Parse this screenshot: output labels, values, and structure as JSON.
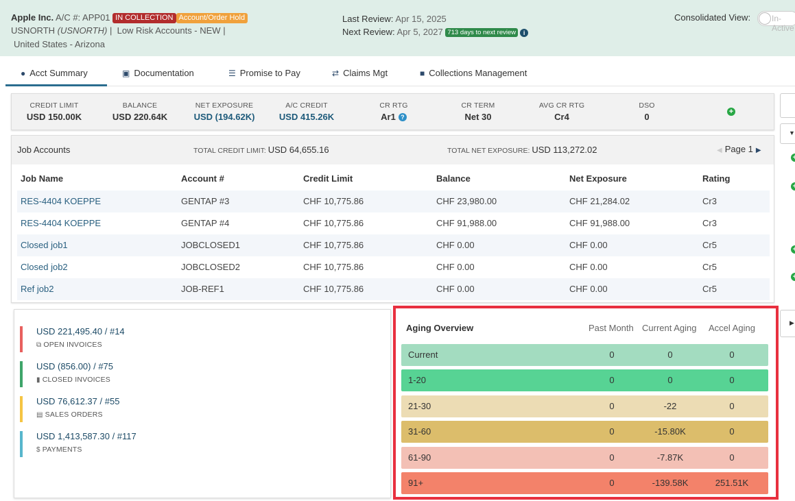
{
  "header": {
    "company": "Apple Inc.",
    "account_label": "A/C #: APP01",
    "badge_collection": "IN COLLECTION",
    "badge_hold": "Account/Order Hold",
    "region": "USNORTH",
    "region_italic": "(USNORTH)",
    "risk": "Low Risk Accounts - NEW",
    "location": "United States - Arizona",
    "last_review_label": "Last Review:",
    "last_review_value": "Apr 15, 2025",
    "next_review_label": "Next Review:",
    "next_review_value": "Apr 5, 2027",
    "days_badge": "713 days to next review",
    "consolidated_label": "Consolidated View:",
    "toggle_label": "In-Active"
  },
  "tabs": [
    {
      "label": "Acct Summary",
      "icon": "user-icon"
    },
    {
      "label": "Documentation",
      "icon": "document-icon"
    },
    {
      "label": "Promise to Pay",
      "icon": "list-icon"
    },
    {
      "label": "Claims Mgt",
      "icon": "shuffle-icon"
    },
    {
      "label": "Collections Management",
      "icon": "collections-icon"
    }
  ],
  "metrics": [
    {
      "label": "CREDIT LIMIT",
      "value": "USD 150.00K"
    },
    {
      "label": "BALANCE",
      "value": "USD 220.64K"
    },
    {
      "label": "NET EXPOSURE",
      "value": "USD (194.62K)"
    },
    {
      "label": "A/C CREDIT",
      "value": "USD 415.26K"
    },
    {
      "label": "CR RTG",
      "value": "Ar1"
    },
    {
      "label": "CR TERM",
      "value": "Net 30"
    },
    {
      "label": "AVG CR RTG",
      "value": "Cr4"
    },
    {
      "label": "DSO",
      "value": "0"
    }
  ],
  "jobs": {
    "title": "Job Accounts",
    "total_credit_label": "TOTAL CREDIT LIMIT:",
    "total_credit_value": "USD 64,655.16",
    "total_net_label": "TOTAL NET EXPOSURE:",
    "total_net_value": "USD 113,272.02",
    "page_label": "Page 1",
    "columns": [
      "Job Name",
      "Account #",
      "Credit Limit",
      "Balance",
      "Net Exposure",
      "Rating"
    ],
    "rows": [
      [
        "RES-4404 KOEPPE",
        "GENTAP #3",
        "CHF 10,775.86",
        "CHF 23,980.00",
        "CHF 21,284.02",
        "Cr3"
      ],
      [
        "RES-4404 KOEPPE",
        "GENTAP #4",
        "CHF 10,775.86",
        "CHF 91,988.00",
        "CHF 91,988.00",
        "Cr3"
      ],
      [
        "Closed job1",
        "JOBCLOSED1",
        "CHF 10,775.86",
        "CHF 0.00",
        "CHF 0.00",
        "Cr5"
      ],
      [
        "Closed job2",
        "JOBCLOSED2",
        "CHF 10,775.86",
        "CHF 0.00",
        "CHF 0.00",
        "Cr5"
      ],
      [
        "Ref job2",
        "JOB-REF1",
        "CHF 10,775.86",
        "CHF 0.00",
        "CHF 0.00",
        "Cr5"
      ]
    ]
  },
  "summary": [
    {
      "value": "USD 221,495.40 / #14",
      "label": "OPEN INVOICES",
      "color": "#e8605e",
      "icon": "copy-icon"
    },
    {
      "value": "USD (856.00) / #75",
      "label": "CLOSED INVOICES",
      "color": "#3fa56a",
      "icon": "file-icon"
    },
    {
      "value": "USD 76,612.37 / #55",
      "label": "SALES ORDERS",
      "color": "#f5c543",
      "icon": "file-text-icon"
    },
    {
      "value": "USD 1,413,587.30 / #117",
      "label": "PAYMENTS",
      "color": "#57b6cc",
      "icon": "dollar-icon"
    }
  ],
  "aging": {
    "title": "Aging Overview",
    "columns": [
      "Past Month",
      "Current Aging",
      "Accel Aging"
    ],
    "rows": [
      {
        "name": "Current",
        "past": "0",
        "current": "0",
        "accel": "0",
        "color": "#a3dcc0"
      },
      {
        "name": "1-20",
        "past": "0",
        "current": "0",
        "accel": "0",
        "color": "#57d394"
      },
      {
        "name": "21-30",
        "past": "0",
        "current": "-22",
        "accel": "0",
        "color": "#ecdcb4"
      },
      {
        "name": "31-60",
        "past": "0",
        "current": "-15.80K",
        "accel": "0",
        "color": "#dcbd6b"
      },
      {
        "name": "61-90",
        "past": "0",
        "current": "-7.87K",
        "accel": "0",
        "color": "#f3c0b5"
      },
      {
        "name": "91+",
        "past": "0",
        "current": "-139.58K",
        "accel": "251.51K",
        "color": "#f3826a"
      }
    ]
  }
}
